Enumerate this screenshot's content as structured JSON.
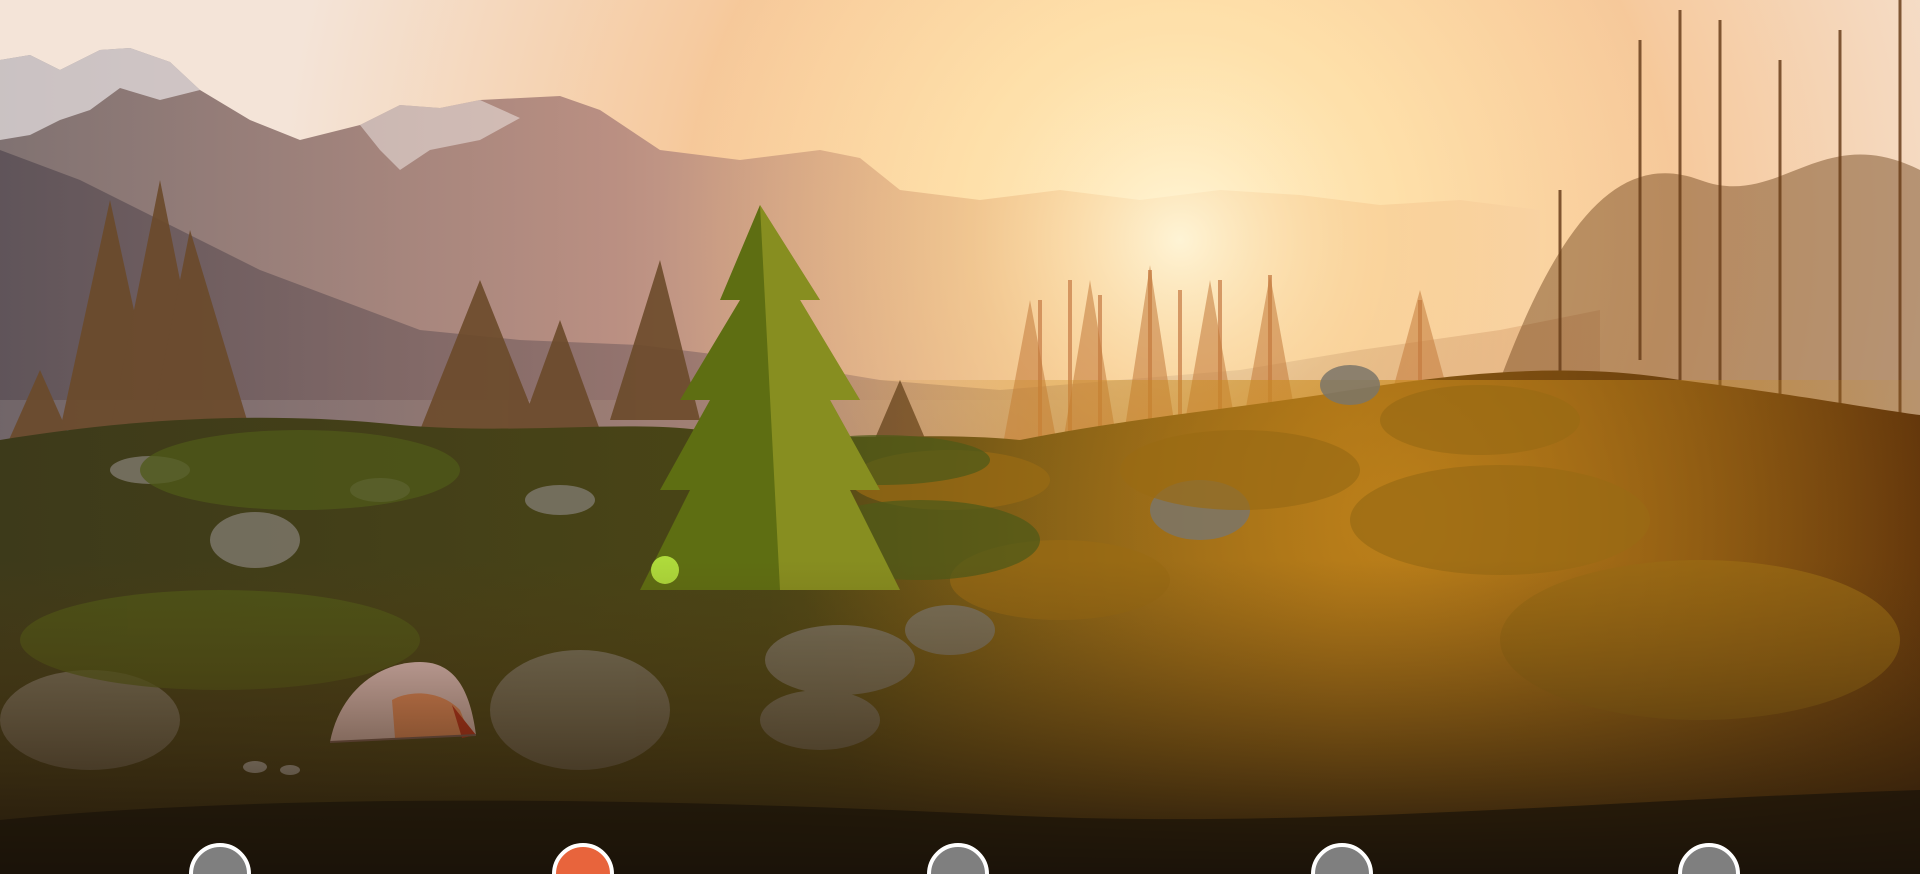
{
  "hero": {
    "image_icon": "mountain-sunset-camping-photo",
    "alt": ""
  },
  "carousel": {
    "slides": [
      {
        "index": 1,
        "active": false
      },
      {
        "index": 2,
        "active": true
      },
      {
        "index": 3,
        "active": false
      },
      {
        "index": 4,
        "active": false
      },
      {
        "index": 5,
        "active": false
      }
    ],
    "colors": {
      "active": "#e8643c",
      "inactive": "#7f7f7f",
      "border": "#ffffff"
    }
  }
}
